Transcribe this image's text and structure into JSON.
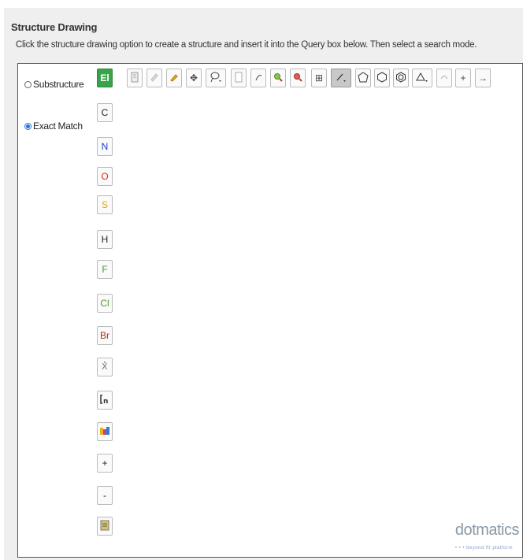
{
  "header": {
    "title": "Structure Drawing",
    "instructions": "Click the structure drawing option to create a structure and insert it into the Query box below. Then select a search mode."
  },
  "search_modes": [
    {
      "label": "Substructure",
      "selected": false
    },
    {
      "label": "Exact Match",
      "selected": true
    }
  ],
  "element_toolbar": {
    "items": [
      "El",
      "C",
      "N",
      "O",
      "S",
      "H",
      "F",
      "Cl",
      "Br"
    ],
    "colors": {
      "El": "#ffffff",
      "C": "#222222",
      "N": "#1f3fd6",
      "O": "#e0281e",
      "S": "#d9a21c",
      "H": "#222222",
      "F": "#4f9a2a",
      "Cl": "#4f9a2a",
      "Br": "#a0351e"
    },
    "extra_tools": [
      "periodic-table-icon",
      "bracket-icon",
      "color-palette-icon",
      "+",
      "-",
      "template-icon"
    ],
    "plus_label": "+",
    "minus_label": "-"
  },
  "main_toolbar": {
    "tools": [
      "document-icon",
      "eraser-disabled-icon",
      "pen-icon",
      "move-icon",
      "lasso-icon",
      "new-page-icon",
      "rotate-icon",
      "zoom-in-icon",
      "zoom-out-icon",
      "grid-icon",
      "bond-icon",
      "pentagon-icon",
      "hexagon-icon",
      "benzene-icon",
      "triangle-icon",
      "chain-icon",
      "plus-icon",
      "arrow-icon"
    ],
    "plus_label": "+",
    "arrow_label": "→"
  },
  "brand": {
    "name": "dotmatics",
    "tagline": "• • • beyond fit platform"
  }
}
